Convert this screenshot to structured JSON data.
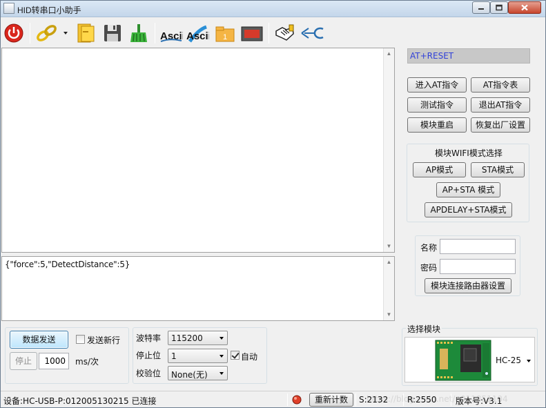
{
  "window": {
    "title": "HID转串口小助手"
  },
  "toolbar": {
    "items": [
      "power-icon",
      "link-icon",
      "open-folder-icon",
      "save-icon",
      "clear-broom-icon",
      "ascii-send-icon",
      "ascii-receive-icon",
      "tab-counter-icon",
      "device-icon",
      "handshake-icon",
      "hc-logo-icon"
    ],
    "tab_counter_label": "1",
    "ascii_label": "Ascii"
  },
  "send_box": {
    "text": "{\"force\":5,\"DetectDistance\":5}"
  },
  "at_panel": {
    "current_command": "AT+RESET",
    "buttons": [
      "进入AT指令",
      "AT指令表",
      "测试指令",
      "退出AT指令",
      "模块重启",
      "恢复出厂设置"
    ]
  },
  "wifi_mode": {
    "title": "模块WIFI模式选择",
    "ap": "AP模式",
    "sta": "STA模式",
    "ap_sta": "AP+STA 模式",
    "apdelay_sta": "APDELAY+STA模式"
  },
  "router": {
    "name_label": "名称",
    "name_value": "",
    "password_label": "密码",
    "password_value": "",
    "config_button": "模块连接路由器设置"
  },
  "send_controls": {
    "send_button": "数据发送",
    "newline_label": "发送新行",
    "newline_checked": false,
    "stop_button": "停止",
    "interval_value": "1000",
    "interval_unit": "ms/次"
  },
  "serial": {
    "baud_label": "波特率",
    "baud_value": "115200",
    "stop_label": "停止位",
    "stop_value": "1",
    "parity_label": "校验位",
    "parity_value": "None(无)",
    "auto_label": "自动",
    "auto_checked": true
  },
  "module_select": {
    "title": "选择模块",
    "selected": "HC-25"
  },
  "status_bar": {
    "device": "设备:HC-USB-P:012005130215 已连接",
    "reset_count": "重新计数",
    "sent": "S:2132",
    "received": "R:2550",
    "version": "版本号:V3.1",
    "watermark": "https://blog.csdn.net/u011851104"
  },
  "colors": {
    "at_command_text": "#3040d8",
    "power_red": "#d9261c",
    "status_led": "#e0402a"
  }
}
